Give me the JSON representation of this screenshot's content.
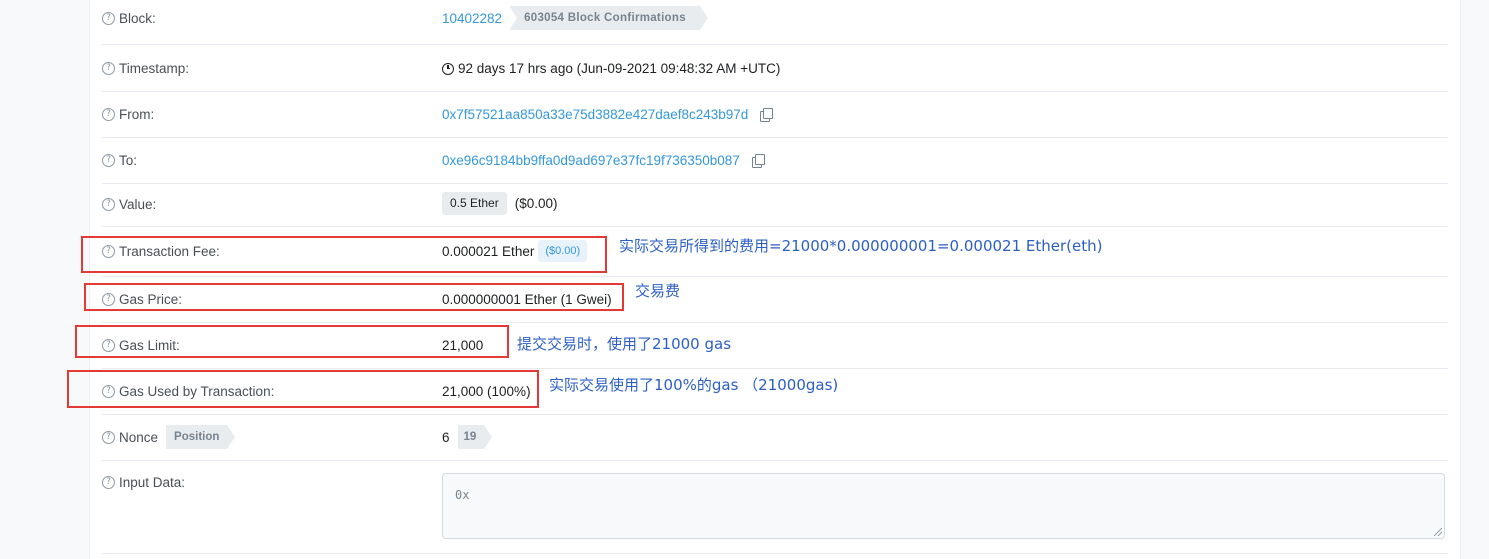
{
  "rows": {
    "block": {
      "label": "Block:",
      "number": "10402282",
      "confirmations": "603054 Block Confirmations"
    },
    "timestamp": {
      "label": "Timestamp:",
      "text": "92 days 17 hrs ago (Jun-09-2021 09:48:32 AM +UTC)"
    },
    "from": {
      "label": "From:",
      "address": "0x7f57521aa850a33e75d3882e427daef8c243b97d"
    },
    "to": {
      "label": "To:",
      "address": "0xe96c9184bb9ffa0d9ad697e37fc19f736350b087"
    },
    "value": {
      "label": "Value:",
      "amount": "0.5 Ether",
      "usd": "($0.00)"
    },
    "fee": {
      "label": "Transaction Fee:",
      "amount": "0.000021 Ether",
      "usd": "($0.00)"
    },
    "gas_price": {
      "label": "Gas Price:",
      "amount": "0.000000001 Ether (1 Gwei)"
    },
    "gas_limit": {
      "label": "Gas Limit:",
      "amount": "21,000"
    },
    "gas_used": {
      "label": "Gas Used by Transaction:",
      "amount": "21,000 (100%)"
    },
    "nonce": {
      "label": "Nonce",
      "position_label": "Position",
      "nonce_value": "6",
      "position_value": "19"
    },
    "input": {
      "label": "Input Data:",
      "content": "0x"
    }
  },
  "annotations": {
    "fee_note": "实际交易所得到的费用=21000*0.000000001=0.000021 Ether(eth)",
    "gas_price_note": "交易费",
    "gas_limit_note": "提交交易时，使用了21000 gas",
    "gas_used_note": "实际交易使用了100%的gas （21000gas)"
  },
  "help_icon_glyph": "?",
  "colors": {
    "link": "#3498db",
    "annotation_box": "#e53935",
    "annotation_text": "#2b5fc6"
  }
}
